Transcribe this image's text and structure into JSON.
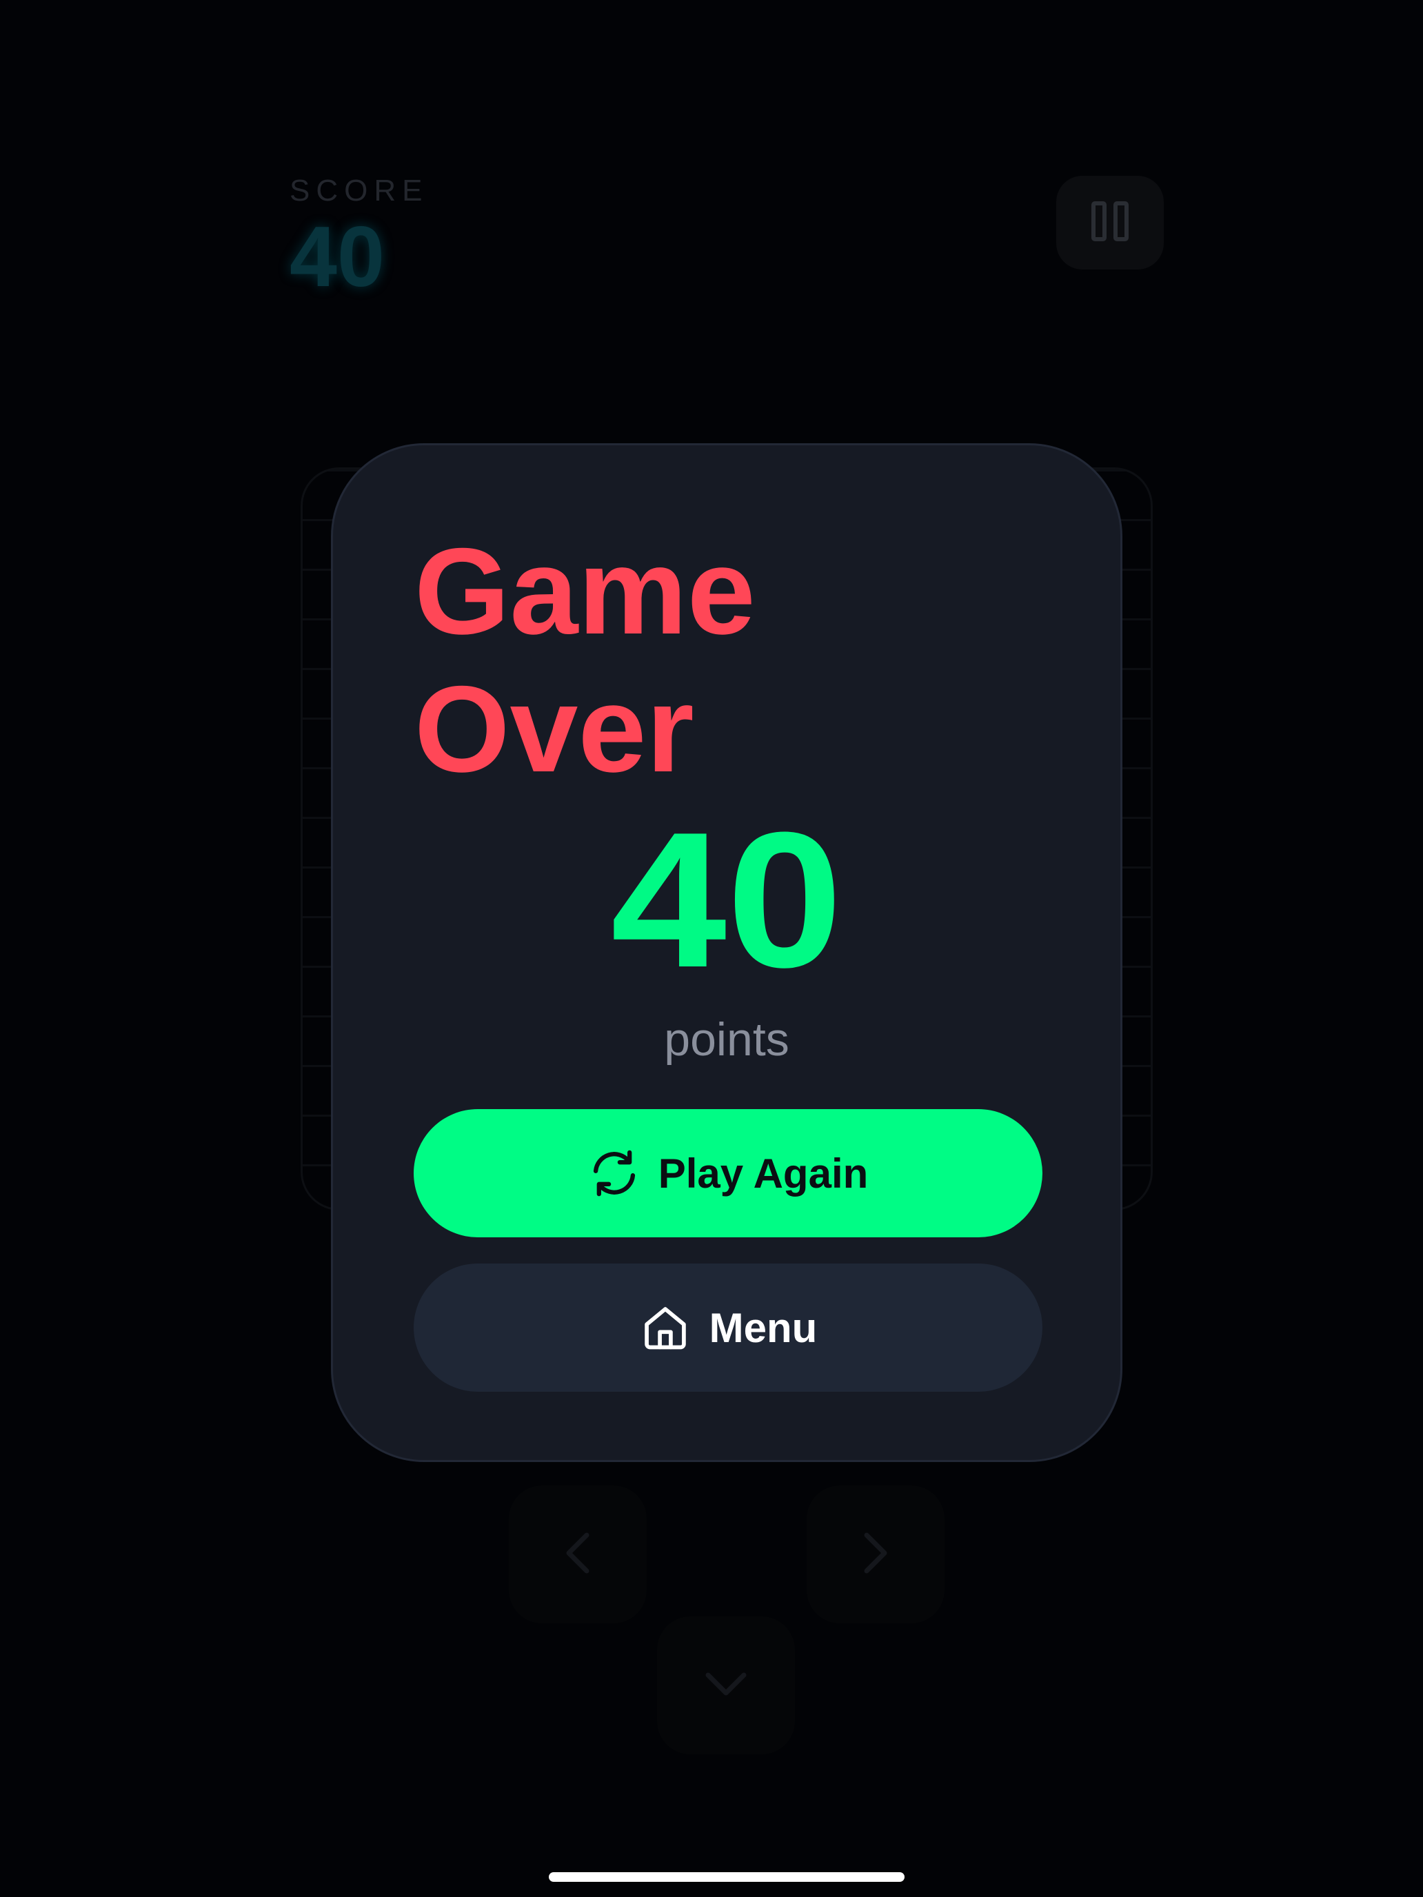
{
  "hud": {
    "score_label": "SCORE",
    "score_value": "40"
  },
  "controls": {
    "pause_icon": "pause-icon",
    "left_icon": "chevron-left-icon",
    "right_icon": "chevron-right-icon",
    "down_icon": "chevron-down-icon"
  },
  "dialog": {
    "title": "Game Over",
    "final_score": "40",
    "points_label": "points",
    "play_again_label": "Play Again",
    "play_again_icon": "refresh-icon",
    "menu_label": "Menu",
    "menu_icon": "home-icon"
  },
  "colors": {
    "title": "#ff4757",
    "score": "#00fa85",
    "primary_button": "#00fc85",
    "secondary_button": "#1f2736",
    "dialog_background": "#161a24",
    "background": "#020306"
  }
}
